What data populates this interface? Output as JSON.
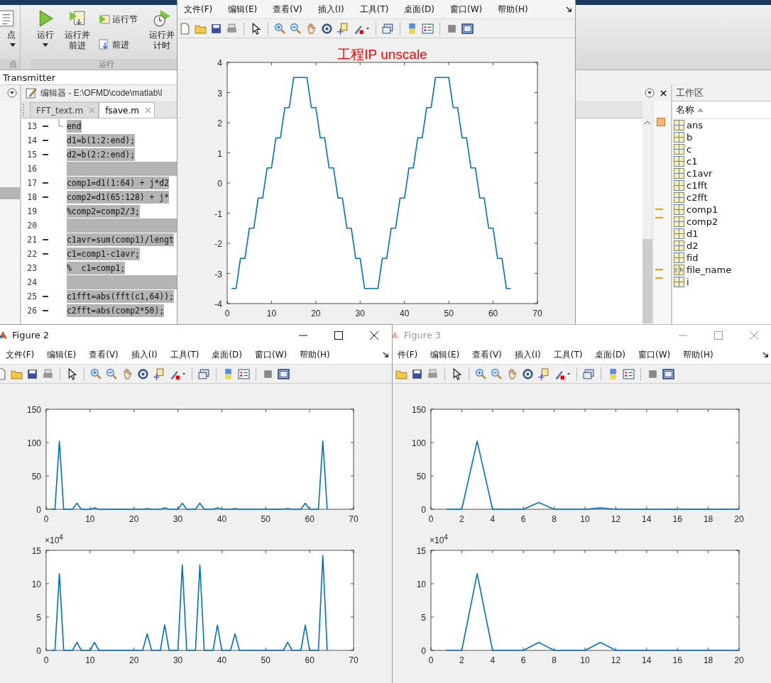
{
  "ribbon": {
    "groups": [
      {
        "label": "点",
        "buttons": [
          {
            "kind": "large",
            "label": "点",
            "dropdown": true
          }
        ]
      },
      {
        "label": "运行",
        "buttons": [
          {
            "kind": "large",
            "label": "运行",
            "dropdown": true
          },
          {
            "kind": "large",
            "label": "运行并前进",
            "dropdown": false
          },
          {
            "kind": "small",
            "label": "运行节"
          },
          {
            "kind": "small",
            "label": "前进"
          },
          {
            "kind": "large",
            "label": "运行并计时",
            "dropdown": false
          }
        ]
      }
    ]
  },
  "address": "Transmitter",
  "editor": {
    "title": "编辑器 - E:\\OFMD\\code\\matlab\\l",
    "tabs": [
      {
        "label": "FFT_text.m",
        "selected": false
      },
      {
        "label": "fsave.m",
        "selected": true
      }
    ],
    "lines": [
      {
        "number": "13",
        "executable": true,
        "highlighted": true,
        "fold_end": true,
        "code": "end"
      },
      {
        "number": "14",
        "executable": true,
        "highlighted": true,
        "code": "d1=b(1:2:end);"
      },
      {
        "number": "15",
        "executable": true,
        "highlighted": true,
        "code": "d2=b(2:2:end);"
      },
      {
        "number": "16",
        "executable": false,
        "highlighted": true
      },
      {
        "number": "17",
        "executable": true,
        "highlighted": true,
        "code": "comp1=d1(1:64) + j*d2"
      },
      {
        "number": "18",
        "executable": true,
        "highlighted": true,
        "code": "comp2=d1(65:128) + j*"
      },
      {
        "number": "19",
        "executable": false,
        "highlighted": true,
        "code": "%comp2=comp2/3;"
      },
      {
        "number": "20",
        "executable": false,
        "highlighted": true
      },
      {
        "number": "21",
        "executable": true,
        "highlighted": true,
        "code": "c1avr=sum(comp1)/lengt"
      },
      {
        "number": "22",
        "executable": true,
        "highlighted": true,
        "code": "c1=comp1-c1avr;"
      },
      {
        "number": "23",
        "executable": false,
        "highlighted": true,
        "code": "%  c1=comp1;"
      },
      {
        "number": "24",
        "executable": false,
        "highlighted": true
      },
      {
        "number": "25",
        "executable": true,
        "highlighted": true,
        "code": "c1fft=abs(fft(c1,64));"
      },
      {
        "number": "26",
        "executable": true,
        "highlighted": true,
        "code": "c2fft=abs(comp2*50);"
      }
    ]
  },
  "workspace": {
    "title": "工作区",
    "column": "名称",
    "sort_ascending": true,
    "variables": [
      {
        "name": "ans",
        "kind": "matrix"
      },
      {
        "name": "b",
        "kind": "matrix"
      },
      {
        "name": "c",
        "kind": "matrix"
      },
      {
        "name": "c1",
        "kind": "matrix"
      },
      {
        "name": "c1avr",
        "kind": "matrix"
      },
      {
        "name": "c1fft",
        "kind": "matrix"
      },
      {
        "name": "c2fft",
        "kind": "matrix"
      },
      {
        "name": "comp1",
        "kind": "matrix"
      },
      {
        "name": "comp2",
        "kind": "matrix"
      },
      {
        "name": "d1",
        "kind": "matrix"
      },
      {
        "name": "d2",
        "kind": "matrix"
      },
      {
        "name": "fid",
        "kind": "matrix"
      },
      {
        "name": "file_name",
        "kind": "char"
      },
      {
        "name": "i",
        "kind": "matrix"
      }
    ]
  },
  "figures": [
    {
      "menu": [
        "文件(F)",
        "编辑(E)",
        "查看(V)",
        "插入(I)",
        "工具(T)",
        "桌面(D)",
        "窗口(W)",
        "帮助(H)"
      ],
      "axes": [
        {
          "chart_data": {
            "type": "line",
            "title": "工程IP unscale",
            "xlim": [
              0,
              70
            ],
            "ylim": [
              -4,
              4
            ],
            "xticks": [
              0,
              10,
              20,
              30,
              40,
              50,
              60,
              70
            ],
            "yticks": [
              -4,
              -3,
              -2,
              -1,
              0,
              1,
              2,
              3,
              4
            ],
            "x": [
              1,
              2,
              3,
              4,
              5,
              6,
              7,
              8,
              9,
              10,
              11,
              12,
              13,
              14,
              15,
              16,
              17,
              18,
              19,
              20,
              21,
              22,
              23,
              24,
              25,
              26,
              27,
              28,
              29,
              30,
              31,
              32,
              33,
              34,
              35,
              36,
              37,
              38,
              39,
              40,
              41,
              42,
              43,
              44,
              45,
              46,
              47,
              48,
              49,
              50,
              51,
              52,
              53,
              54,
              55,
              56,
              57,
              58,
              59,
              60,
              61,
              62,
              63,
              64
            ],
            "values": [
              -3.5,
              -3.5,
              -2.5,
              -2.5,
              -1.5,
              -1.5,
              -0.5,
              -0.5,
              0.5,
              0.5,
              1.5,
              1.5,
              2.5,
              2.5,
              3.5,
              3.5,
              3.5,
              3.5,
              2.5,
              2.5,
              1.5,
              1.5,
              0.5,
              0.5,
              -0.5,
              -0.5,
              -1.5,
              -1.5,
              -2.5,
              -2.5,
              -3.5,
              -3.5,
              -3.5,
              -3.5,
              -2.5,
              -2.5,
              -1.5,
              -1.5,
              -0.5,
              -0.5,
              0.5,
              0.5,
              1.5,
              1.5,
              2.5,
              2.5,
              3.5,
              3.5,
              3.5,
              3.5,
              2.5,
              2.5,
              1.5,
              1.5,
              0.5,
              0.5,
              -0.5,
              -0.5,
              -1.5,
              -1.5,
              -2.5,
              -2.5,
              -3.5,
              -3.5
            ]
          }
        }
      ]
    },
    {
      "title": "Figure 2",
      "active": true,
      "menu": [
        "文件(F)",
        "编辑(E)",
        "查看(V)",
        "插入(I)",
        "工具(T)",
        "桌面(D)",
        "窗口(W)",
        "帮助(H)"
      ],
      "axes": [
        {
          "chart_data": {
            "type": "line",
            "xlim": [
              0,
              70
            ],
            "ylim": [
              0,
              150
            ],
            "xticks": [
              0,
              10,
              20,
              30,
              40,
              50,
              60,
              70
            ],
            "yticks": [
              0,
              50,
              100,
              150
            ],
            "x": [
              1,
              2,
              3,
              4,
              5,
              6,
              7,
              8,
              9,
              10,
              11,
              12,
              13,
              14,
              15,
              16,
              17,
              18,
              19,
              20,
              21,
              22,
              23,
              24,
              25,
              26,
              27,
              28,
              29,
              30,
              31,
              32,
              33,
              34,
              35,
              36,
              37,
              38,
              39,
              40,
              41,
              42,
              43,
              44,
              45,
              46,
              47,
              48,
              49,
              50,
              51,
              52,
              53,
              54,
              55,
              56,
              57,
              58,
              59,
              60,
              61,
              62,
              63,
              64
            ],
            "values": [
              0,
              0,
              102,
              0,
              0,
              0,
              9,
              0,
              0,
              0,
              2,
              0,
              0,
              0,
              0,
              0,
              0,
              0,
              0,
              0,
              0,
              0,
              1,
              0,
              0,
              0,
              2,
              0,
              0,
              0,
              9,
              0,
              0,
              0,
              9,
              0,
              0,
              0,
              2,
              0,
              0,
              0,
              1,
              0,
              0,
              0,
              0,
              0,
              0,
              0,
              0,
              0,
              0,
              0,
              1,
              0,
              0,
              0,
              9,
              0,
              0,
              0,
              102,
              0
            ]
          }
        },
        {
          "exponent_label": "×10$^{4}$",
          "chart_data": {
            "type": "line",
            "xlim": [
              0,
              70
            ],
            "ylim": [
              0,
              15
            ],
            "xticks": [
              0,
              10,
              20,
              30,
              40,
              50,
              60,
              70
            ],
            "yticks": [
              0,
              5,
              10,
              15
            ],
            "x": [
              1,
              2,
              3,
              4,
              5,
              6,
              7,
              8,
              9,
              10,
              11,
              12,
              13,
              14,
              15,
              16,
              17,
              18,
              19,
              20,
              21,
              22,
              23,
              24,
              25,
              26,
              27,
              28,
              29,
              30,
              31,
              32,
              33,
              34,
              35,
              36,
              37,
              38,
              39,
              40,
              41,
              42,
              43,
              44,
              45,
              46,
              47,
              48,
              49,
              50,
              51,
              52,
              53,
              54,
              55,
              56,
              57,
              58,
              59,
              60,
              61,
              62,
              63,
              64
            ],
            "values": [
              0,
              0,
              11.5,
              0,
              0,
              0,
              1.2,
              0,
              0,
              0,
              1.2,
              0,
              0,
              0,
              0,
              0,
              0,
              0,
              0,
              0,
              0,
              0,
              2.5,
              0,
              0,
              0,
              3.8,
              0,
              0,
              0,
              12.8,
              0,
              0,
              0,
              12.8,
              0,
              0,
              0,
              3.8,
              0,
              0,
              0,
              2.5,
              0,
              0,
              0,
              0,
              0,
              0,
              0,
              0,
              0,
              0,
              0,
              1.2,
              0,
              0,
              0,
              3.8,
              0,
              0,
              0,
              14.2,
              0
            ]
          }
        }
      ]
    },
    {
      "title": "Figure 3",
      "active": false,
      "menu": [
        "件(F)",
        "编辑(E)",
        "查看(V)",
        "插入(I)",
        "工具(T)",
        "桌面(D)",
        "窗口(W)",
        "帮助(H)"
      ],
      "axes": [
        {
          "chart_data": {
            "type": "line",
            "xlim": [
              0,
              20
            ],
            "ylim": [
              0,
              150
            ],
            "xticks": [
              0,
              2,
              4,
              6,
              8,
              10,
              12,
              14,
              16,
              18,
              20
            ],
            "yticks": [
              0,
              50,
              100,
              150
            ],
            "x": [
              1,
              2,
              3,
              4,
              5,
              6,
              7,
              8,
              9,
              10,
              11,
              12,
              13,
              14,
              15,
              16,
              17,
              18,
              19,
              20
            ],
            "values": [
              0,
              0,
              102,
              0,
              0,
              0,
              10,
              0,
              0,
              0,
              2,
              0,
              0,
              0,
              0,
              0,
              0,
              0,
              0,
              0
            ]
          }
        },
        {
          "exponent_label": "×10$^{4}$",
          "chart_data": {
            "type": "line",
            "xlim": [
              0,
              20
            ],
            "ylim": [
              0,
              15
            ],
            "xticks": [
              0,
              2,
              4,
              6,
              8,
              10,
              12,
              14,
              16,
              18,
              20
            ],
            "yticks": [
              0,
              5,
              10,
              15
            ],
            "x": [
              1,
              2,
              3,
              4,
              5,
              6,
              7,
              8,
              9,
              10,
              11,
              12,
              13,
              14,
              15,
              16,
              17,
              18,
              19,
              20
            ],
            "values": [
              0,
              0,
              11.5,
              0,
              0,
              0,
              1.2,
              0,
              0,
              0,
              1.2,
              0,
              0,
              0,
              0,
              0,
              0,
              0,
              0,
              0
            ]
          }
        }
      ]
    }
  ]
}
